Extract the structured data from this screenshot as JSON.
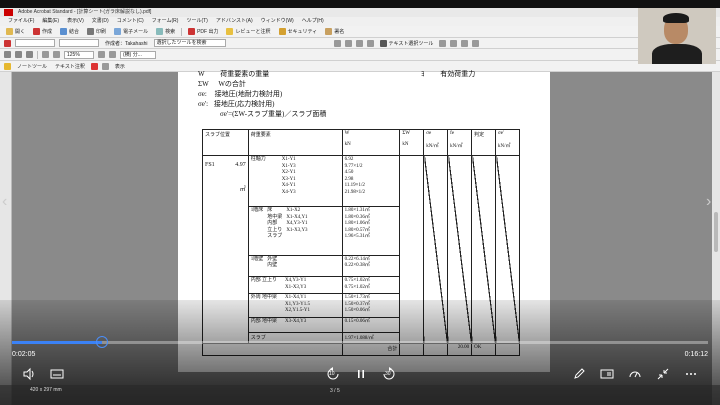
{
  "window": {
    "title": "Adobe Acrobat Standard - [計算シート(ガラ床解説なし).pdf]"
  },
  "menu": [
    "ファイル(F)",
    "編集(E)",
    "表示(V)",
    "文書(D)",
    "コメント(C)",
    "フォーム(R)",
    "ツール(T)",
    "アドバンスト(A)",
    "ウィンドウ(W)",
    "ヘルプ(H)"
  ],
  "toolbar1": [
    "開く",
    "作成",
    "結合",
    "印刷",
    "電子メール",
    "検索",
    "PDF 出力",
    "レビューと注釈",
    "セキュリティ",
    "署名"
  ],
  "toolbar2": {
    "name_label": "作成者：Takahashi",
    "placeholder": "選択したツールを検索",
    "select_tool": "テキスト選択ツール"
  },
  "toolbar3": {
    "zoom": "125%",
    "page_label": "(横) 分... "
  },
  "toolbar4": [
    "ノートツール",
    "テキスト注釈",
    "表示"
  ],
  "doc": {
    "line1_a": "W",
    "line1_b": "荷重要素の重量",
    "line1_c": "ﾖ",
    "line1_d": "有効荷重力",
    "line2_a": "ΣW",
    "line2_b": "Wの合計",
    "line3_a": "σe:",
    "line3_b": "接地圧(地耐力検討用)",
    "line4_a": "σe':",
    "line4_b": "接地圧(応力検討用)",
    "formula": "σe'=(ΣW-スラブ重量)／スラブ面積"
  },
  "table": {
    "headers": {
      "slab_pos": "スラブ位置",
      "load": "荷重要素",
      "w": "W",
      "w_unit": "kN",
      "sum_w": "ΣW",
      "sum_w_unit": "kN",
      "se": "σe",
      "se_unit": "kN/㎡",
      "fe": "fe",
      "fe_unit": "kN/㎡",
      "judge": "判定",
      "se2": "σe'",
      "se2_unit": "kN/㎡"
    },
    "slab": {
      "name": "FS1",
      "area": "4.97",
      "area_unit": "㎡"
    },
    "groups": [
      {
        "label": "柱軸力",
        "members": [
          "X1-Y1",
          "X1-Y3",
          "X2-Y1",
          "X3-Y1",
          "X4-Y1",
          "X4-Y3"
        ],
        "values": [
          "6.92",
          "9.77×1/2",
          "4.50",
          "2.98",
          "11.19×1/2",
          "21.98×1/2"
        ]
      },
      {
        "label": "1階床",
        "subs": [
          "床",
          "地中梁",
          "内部",
          "立上り",
          "スラブ"
        ],
        "members": [
          "X1-X2",
          "X1-X4,Y1",
          "X4,Y3-Y1",
          "X1-X3,Y3",
          ""
        ],
        "values": [
          "1.80×1.31㎡",
          "1.80×0.36㎡",
          "1.80×1.06㎡",
          "1.80×0.57㎡",
          "1.96×5.31㎡"
        ]
      },
      {
        "label": "1階壁",
        "subs": [
          "外壁",
          "内壁"
        ],
        "values": [
          "0.22×6.14㎡",
          "0.22×0.38㎡"
        ]
      },
      {
        "label": "内部 立上り",
        "members": [
          "X4,Y3-Y1",
          "X1-X3,Y3"
        ],
        "values": [
          "0.75×1.02㎡",
          "0.75×1.02㎡"
        ]
      },
      {
        "label": "外周 地中梁",
        "members": [
          "X1-X4,Y1",
          "X1,Y3-Y1.5",
          "X2,Y1.5-Y1"
        ],
        "values": [
          "1.50×1.73㎡",
          "1.50×0.37㎡",
          "1.50×0.06㎡"
        ]
      },
      {
        "label": "内部 地中梁",
        "members": [
          "X3-X4,Y3"
        ],
        "values": [
          "0.15×0.06㎡"
        ]
      },
      {
        "label": "スラブ",
        "values": [
          "1.97×1.088/㎡"
        ]
      }
    ],
    "total_label": "合計",
    "total_fe": "20.00",
    "total_judge": "OK"
  },
  "player": {
    "elapsed": "0:02:05",
    "duration": "0:16:12",
    "progress": 0.1286,
    "rewind_label": "10",
    "forward_label": "30"
  },
  "statusbar": {
    "page_num": "3 / 5",
    "page_size": "420 x 297 mm"
  }
}
